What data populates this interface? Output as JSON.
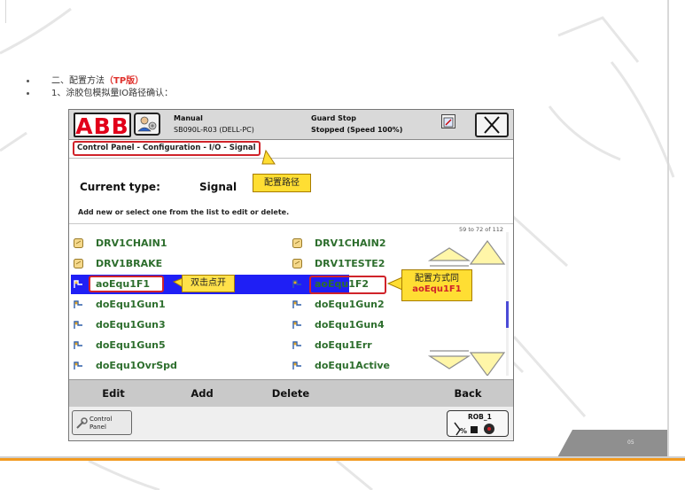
{
  "slide": {
    "bullets": [
      {
        "prefix": "二、配置方法",
        "highlight": "（TP版）"
      },
      {
        "text": "1、涂胶包模拟量IO路径确认："
      }
    ],
    "page_number": "05"
  },
  "tp": {
    "logo": "ABB",
    "status": {
      "mode": "Manual",
      "controller": "SB090L-R03 (DELL-PC)",
      "state": "Guard Stop",
      "run_state": "Stopped (Speed 100%)"
    },
    "breadcrumb": "Control Panel - Configuration - I/O - Signal",
    "current_type_label": "Current type:",
    "current_type_value": "Signal",
    "hint": "Add new or select one from the list to edit or delete.",
    "page_counter": "59 to 72 of 112",
    "signals_left": [
      {
        "name": "DRV1CHAIN1",
        "icon": "config-icon"
      },
      {
        "name": "DRV1BRAKE",
        "icon": "config-icon"
      },
      {
        "name": "aoEqu1F1",
        "icon": "signal-icon",
        "selected": true
      },
      {
        "name": "doEqu1Gun1",
        "icon": "signal-icon"
      },
      {
        "name": "doEqu1Gun3",
        "icon": "signal-icon"
      },
      {
        "name": "doEqu1Gun5",
        "icon": "signal-icon"
      },
      {
        "name": "doEqu1OvrSpd",
        "icon": "signal-icon"
      }
    ],
    "signals_right": [
      {
        "name": "DRV1CHAIN2",
        "icon": "config-icon"
      },
      {
        "name": "DRV1TESTE2",
        "icon": "config-icon"
      },
      {
        "name": "aoEqu1F2",
        "icon": "signal-icon"
      },
      {
        "name": "doEqu1Gun2",
        "icon": "signal-icon"
      },
      {
        "name": "doEqu1Gun4",
        "icon": "signal-icon"
      },
      {
        "name": "doEqu1Err",
        "icon": "signal-icon"
      },
      {
        "name": "doEqu1Active",
        "icon": "signal-icon"
      }
    ],
    "buttons": {
      "edit": "Edit",
      "add": "Add",
      "delete": "Delete",
      "back": "Back"
    },
    "taskbar": {
      "control_panel": "Control\nPanel",
      "rob": "ROB_1"
    }
  },
  "callouts": {
    "path": "配置路径",
    "double_click": "双击点开",
    "same_as_line1": "配置方式同",
    "same_as_line2": "aoEqu1F1"
  },
  "colors": {
    "abb_red": "#e2001a",
    "signal_green": "#2d6e2d",
    "selection_blue": "#1f1ff5",
    "callout_yellow": "#ffde33",
    "annotation_red": "#d0232a",
    "footer_orange": "#f29a1f"
  }
}
